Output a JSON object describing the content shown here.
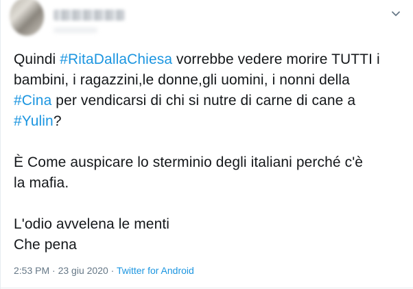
{
  "header": {
    "avatar_icon": "avatar",
    "menu_icon": "chevron-down-icon",
    "accent_color": "#1b95e0"
  },
  "body": {
    "l1_a": "Quindi ",
    "l1_tag": "#RitaDallaChiesa",
    "l1_b": " vorrebbe vedere morire TUTTI i",
    "l2": "bambini, i ragazzini,le donne,gli uomini, i nonni della",
    "l3_tag": "#Cina",
    "l3_b": " per vendicarsi di chi si nutre di carne di cane a",
    "l4_tag": "#Yulin",
    "l4_b": "?",
    "p2_l1": "È Come auspicare lo sterminio degli italiani perché c'è",
    "p2_l2": "la mafia.",
    "p3_l1": "L'odio avvelena le menti",
    "p3_l2": "Che pena"
  },
  "meta": {
    "time": "2:53 PM",
    "date": "23 giu 2020",
    "separator": "·",
    "source": "Twitter for Android"
  }
}
